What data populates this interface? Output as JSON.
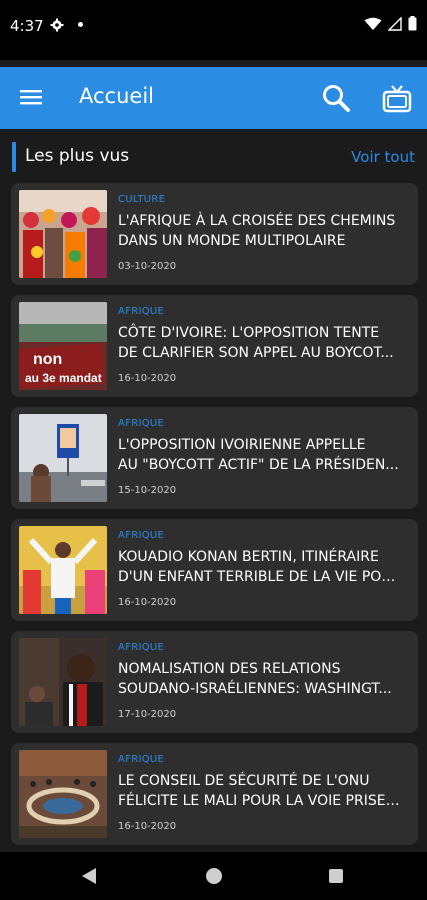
{
  "status": {
    "time": "4:37"
  },
  "appbar": {
    "title": "Accueil"
  },
  "section": {
    "title": "Les plus vus",
    "more_label": "Voir tout"
  },
  "articles": [
    {
      "category": "CULTURE",
      "line1": "L'AFRIQUE À LA CROISÉE DES CHEMINS",
      "line2": "DANS UN MONDE MULTIPOLAIRE",
      "date": "03-10-2020"
    },
    {
      "category": "AFRIQUE",
      "line1": "CÔTE D'IVOIRE: L'OPPOSITION TENTE",
      "line2": "DE CLARIFIER SON APPEL AU BOYCOT...",
      "date": "16-10-2020"
    },
    {
      "category": "AFRIQUE",
      "line1": "L'OPPOSITION IVOIRIENNE APPELLE",
      "line2": "AU \"BOYCOTT ACTIF\" DE LA PRÉSIDEN...",
      "date": "15-10-2020"
    },
    {
      "category": "AFRIQUE",
      "line1": "KOUADIO KONAN BERTIN, ITINÉRAIRE",
      "line2": "D'UN ENFANT TERRIBLE DE LA VIE POLI...",
      "date": "16-10-2020"
    },
    {
      "category": "AFRIQUE",
      "line1": "NOMALISATION DES RELATIONS",
      "line2": "SOUDANO-ISRAÉLIENNES: WASHINGT...",
      "date": "17-10-2020"
    },
    {
      "category": "AFRIQUE",
      "line1": "LE CONSEIL DE SÉCURITÉ DE L'ONU",
      "line2": "FÉLICITE LE MALI POUR LA VOIE PRISE ...",
      "date": "16-10-2020"
    }
  ],
  "thumb_texts": {
    "protest_sign": "non au 3e mandat"
  },
  "colors": {
    "accent": "#2a8ce3",
    "background": "#1b1b1b",
    "card": "#2e2e2e"
  },
  "icons": {
    "menu": "hamburger-icon",
    "search": "search-icon",
    "tv": "tv-icon"
  }
}
